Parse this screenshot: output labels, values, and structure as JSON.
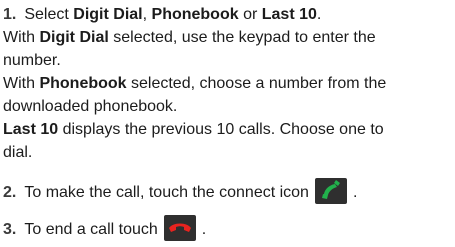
{
  "step1": {
    "number": "1.",
    "select_prefix": "Select ",
    "digit_dial": "Digit Dial",
    "comma": ",",
    "phonebook": "Phonebook",
    "or": " or ",
    "last10": "Last 10",
    "period": ".",
    "with1_prefix": "With ",
    "with1_rest": " selected, use the keypad to enter the",
    "with1_line2": "number.",
    "with2_prefix": "With ",
    "with2_rest": " selected, choose a number from the",
    "with2_line2": "downloaded phonebook.",
    "last10_rest": " displays the previous 10 calls. Choose one to",
    "last10_line2": "dial."
  },
  "step2": {
    "number": "2.",
    "text": "To make the call, touch the connect icon",
    "trailing": "."
  },
  "step3": {
    "number": "3.",
    "text": "To end a call touch",
    "trailing": "."
  },
  "icons": {
    "connect": "phone-connect-icon",
    "end": "phone-end-icon",
    "connect_bg": "#2f2f2f",
    "connect_fg": "#22b14c",
    "end_bg": "#2f2f2f",
    "end_fg": "#e8231f"
  }
}
